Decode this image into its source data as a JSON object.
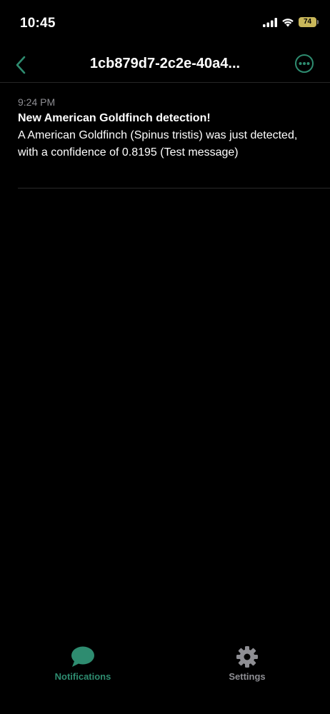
{
  "status_bar": {
    "time": "10:45",
    "battery_level": "74",
    "icons": [
      "signal-bars-icon",
      "wifi-icon",
      "battery-icon"
    ]
  },
  "nav": {
    "title": "1cb879d7-2c2e-40a4...",
    "back_icon": "chevron-left-icon",
    "more_icon": "ellipsis-circle-icon"
  },
  "messages": [
    {
      "time": "9:24 PM",
      "title": "New American Goldfinch detection!",
      "body": "A American Goldfinch (Spinus tristis) was just detected, with a confidence of 0.8195 (Test message)"
    }
  ],
  "tabs": [
    {
      "label": "Notifications",
      "icon": "chat-bubble-icon",
      "active": true
    },
    {
      "label": "Settings",
      "icon": "gear-icon",
      "active": false
    }
  ],
  "colors": {
    "accent": "#2e8c70",
    "background": "#000000",
    "secondary_text": "#8e8e93",
    "inactive_tab": "#8e8e93",
    "battery": "#c9b75a"
  }
}
